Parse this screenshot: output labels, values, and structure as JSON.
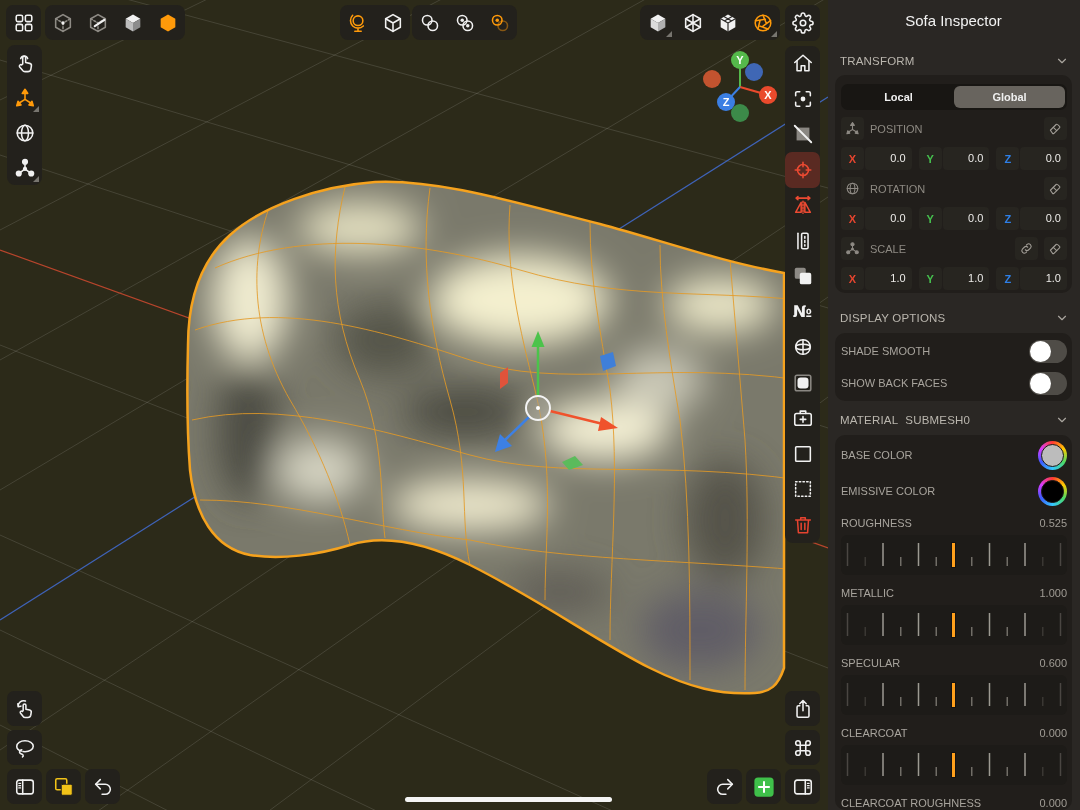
{
  "viewport": {
    "top_toolbar": {
      "groups": [
        {
          "items": [
            {
              "selected": false,
              "has_menu": false
            }
          ]
        },
        {
          "items": [
            {
              "selected": false,
              "has_menu": false
            },
            {
              "selected": false,
              "has_menu": false
            },
            {
              "selected": false,
              "has_menu": false
            },
            {
              "selected": true,
              "has_menu": false
            }
          ]
        },
        {
          "items": [
            {
              "selected": true,
              "has_menu": false
            },
            {
              "selected": false,
              "has_menu": false
            }
          ]
        },
        {
          "items": [
            {
              "selected": false,
              "has_menu": false
            },
            {
              "selected": false,
              "has_menu": false
            },
            {
              "selected": true,
              "has_menu": false
            }
          ]
        },
        {
          "items": [
            {
              "selected": false,
              "has_menu": true
            },
            {
              "selected": false,
              "has_menu": false
            },
            {
              "selected": false,
              "has_menu": false
            },
            {
              "selected": true,
              "has_menu": true
            }
          ]
        }
      ]
    },
    "left_toolbar": {
      "items": [
        {
          "selected": false,
          "has_menu": false
        },
        {
          "selected": true,
          "has_menu": true
        },
        {
          "selected": false,
          "has_menu": false
        },
        {
          "selected": false,
          "has_menu": true
        }
      ]
    },
    "right_toolbar": {
      "groups": [
        {
          "items": [
            {
              "selected": false
            }
          ]
        },
        {
          "items": [
            {
              "selected": false
            },
            {
              "selected": false
            },
            {
              "selected": false
            },
            {
              "selected": true
            },
            {
              "selected": false
            },
            {
              "selected": false
            },
            {
              "selected": false
            },
            {
              "selected": false,
              "glyph": "№"
            },
            {
              "selected": false
            },
            {
              "selected": false
            },
            {
              "selected": false
            },
            {
              "selected": false
            },
            {
              "selected": false
            },
            {
              "selected": false
            }
          ]
        }
      ]
    },
    "bottom_left_tools": {
      "items": [
        {
          "selected": false
        },
        {
          "selected": false
        }
      ]
    },
    "view_gizmo": {
      "axes": [
        {
          "kind": "negative",
          "color": "#c2532f"
        },
        {
          "kind": "negative",
          "color": "#3f67b5"
        },
        {
          "kind": "negative",
          "color": "#3c8a49"
        },
        {
          "kind": "positive",
          "label": "Y",
          "color": "#55b94b"
        },
        {
          "kind": "positive",
          "label": "X",
          "color": "#ea4a2c"
        },
        {
          "kind": "positive",
          "label": "Z",
          "color": "#3b7fe3"
        }
      ]
    }
  },
  "inspector": {
    "title": "Sofa Inspector",
    "transform": {
      "title": "TRANSFORM",
      "expanded": true,
      "space_options": [
        {
          "label": "Local",
          "selected": false
        },
        {
          "label": "Global",
          "selected": true
        }
      ],
      "properties": [
        {
          "label": "POSITION",
          "link_button": false,
          "fields": [
            {
              "label": "X",
              "value": "0.0",
              "color": "#e5452f"
            },
            {
              "label": "Y",
              "value": "0.0",
              "color": "#45c14e"
            },
            {
              "label": "Z",
              "value": "0.0",
              "color": "#2f80e8"
            }
          ]
        },
        {
          "label": "ROTATION",
          "link_button": false,
          "fields": [
            {
              "label": "X",
              "value": "0.0",
              "color": "#e5452f"
            },
            {
              "label": "Y",
              "value": "0.0",
              "color": "#45c14e"
            },
            {
              "label": "Z",
              "value": "0.0",
              "color": "#2f80e8"
            }
          ]
        },
        {
          "label": "SCALE",
          "link_button": true,
          "fields": [
            {
              "label": "X",
              "value": "1.0",
              "color": "#e5452f"
            },
            {
              "label": "Y",
              "value": "1.0",
              "color": "#45c14e"
            },
            {
              "label": "Z",
              "value": "1.0",
              "color": "#2f80e8"
            }
          ]
        }
      ]
    },
    "display_options": {
      "title": "DISPLAY OPTIONS",
      "expanded": true,
      "toggles": [
        {
          "label": "SHADE SMOOTH",
          "on": false
        },
        {
          "label": "SHOW BACK FACES",
          "on": false
        }
      ]
    },
    "material": {
      "title": "MATERIAL",
      "subtitle": "SUBMESH0",
      "expanded": true,
      "colors": [
        {
          "label": "BASE COLOR",
          "color": "#bcbcbc"
        },
        {
          "label": "EMISSIVE COLOR",
          "color": "#000000"
        }
      ],
      "sliders": [
        {
          "label": "ROUGHNESS",
          "reading": "0.525",
          "ruler": true
        },
        {
          "label": "METALLIC",
          "reading": "1.000",
          "ruler": true
        },
        {
          "label": "SPECULAR",
          "reading": "0.600",
          "ruler": true
        },
        {
          "label": "CLEARCOAT",
          "reading": "0.000",
          "ruler": true
        },
        {
          "label": "CLEARCOAT ROUGHNESS",
          "reading": "0.000",
          "ruler": false
        }
      ]
    }
  }
}
